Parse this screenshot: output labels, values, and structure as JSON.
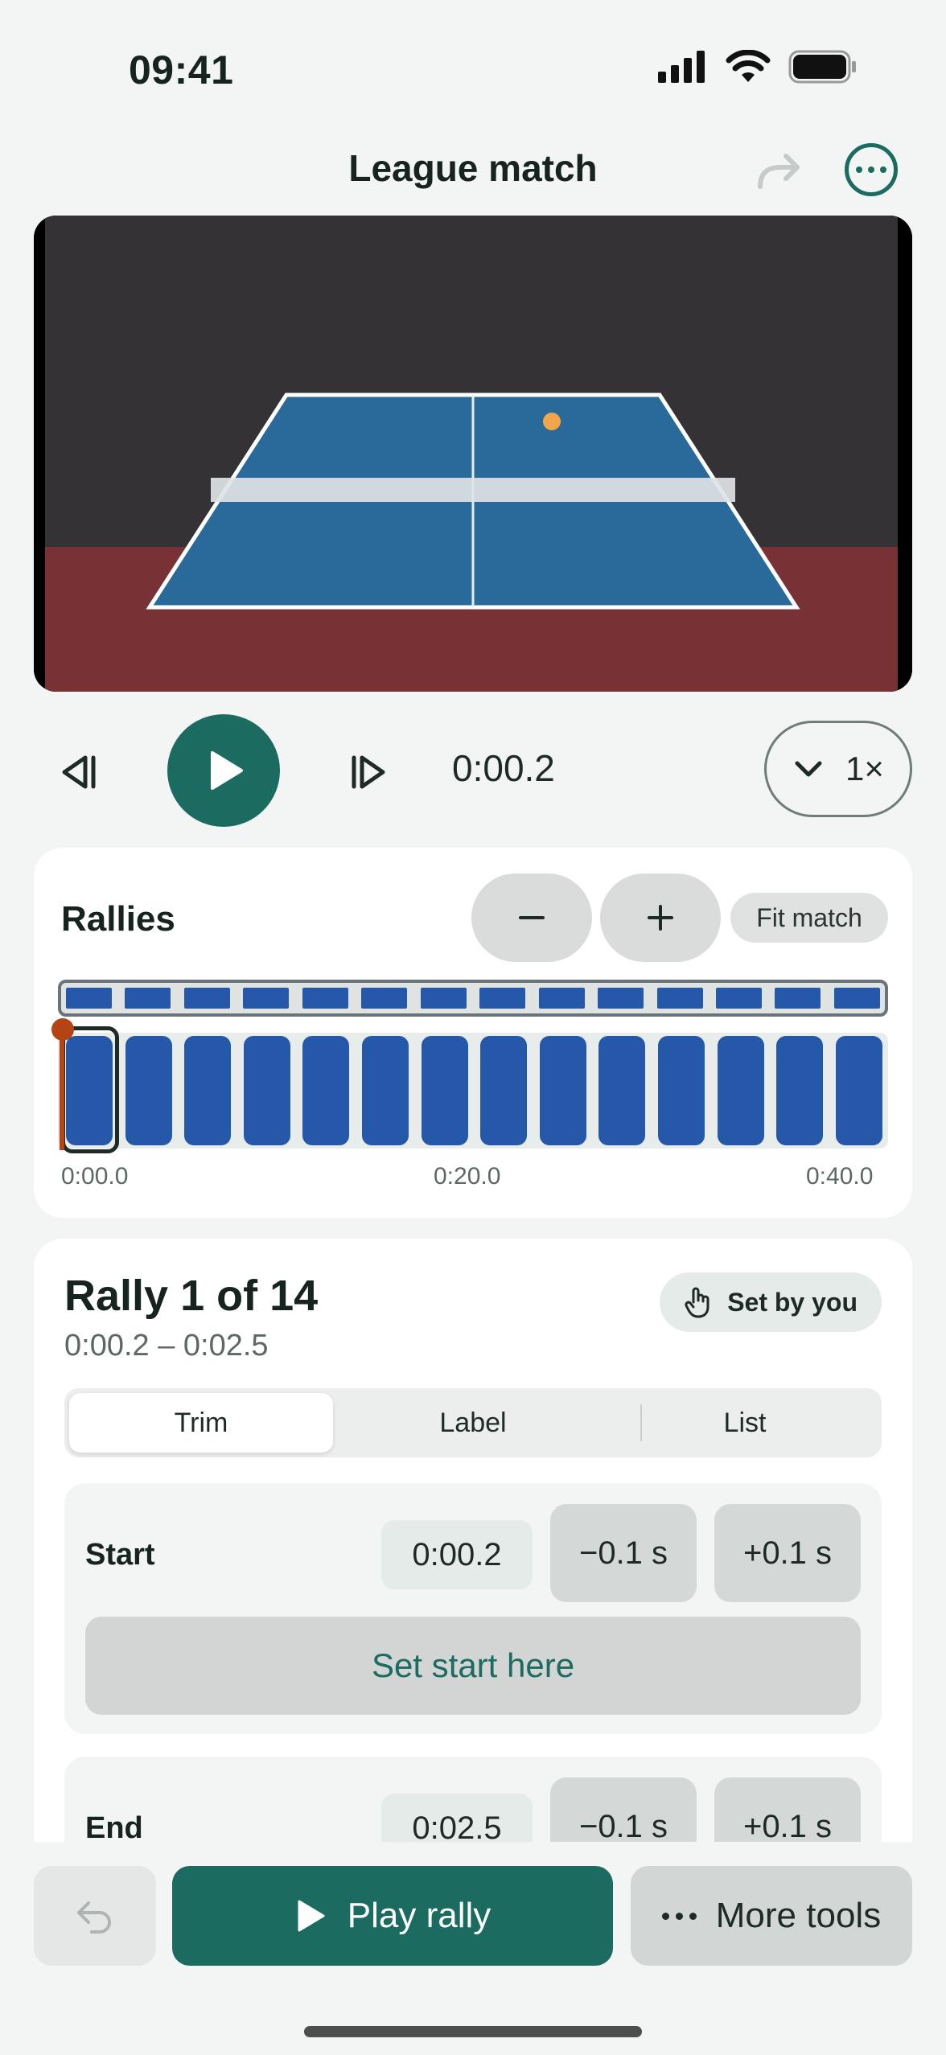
{
  "status": {
    "time": "09:41"
  },
  "header": {
    "title": "League match",
    "redo_icon": "redo-arrow-icon",
    "more_icon": "more-horizontal-icon"
  },
  "video": {
    "content": "ping-pong-table-scene"
  },
  "controls": {
    "current_time": "0:00.2",
    "speed": "1×"
  },
  "rallies": {
    "title": "Rallies",
    "zoom_out": "−",
    "zoom_in": "+",
    "fit_label": "Fit match",
    "count": 14,
    "ticks": [
      "0:00.0",
      "0:20.0",
      "0:40.0"
    ]
  },
  "rally": {
    "title": "Rally 1 of 14",
    "range": "0:00.2 – 0:02.5",
    "source": "Set by you",
    "tabs": [
      "Trim",
      "Label",
      "List"
    ],
    "active_tab": "Trim",
    "start": {
      "label": "Start",
      "value": "0:00.2",
      "minus": "−0.1 s",
      "plus": "+0.1 s",
      "set_label": "Set start here"
    },
    "end": {
      "label": "End",
      "value": "0:02.5",
      "minus": "−0.1 s",
      "plus": "+0.1 s"
    }
  },
  "bottom": {
    "play_label": "Play rally",
    "more_label": "More tools"
  },
  "colors": {
    "accent": "#1b6b60",
    "rally_block": "#2558a8",
    "playhead": "#b44413"
  }
}
